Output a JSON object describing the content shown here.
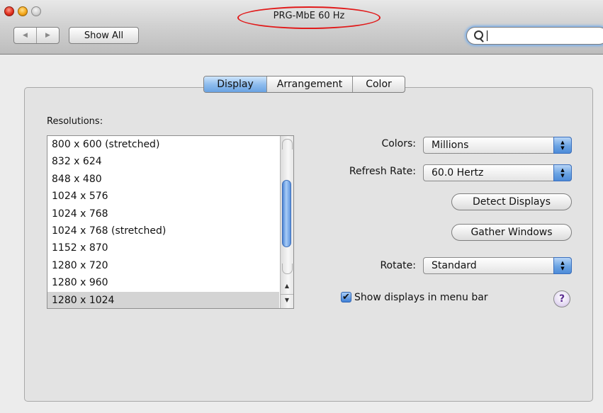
{
  "window": {
    "title": "PRG-MbE 60 Hz",
    "toolbar": {
      "back": "◀",
      "forward": "▶",
      "show_all": "Show All"
    },
    "search": {
      "value": ""
    }
  },
  "tabs": [
    {
      "label": "Display",
      "active": true
    },
    {
      "label": "Arrangement",
      "active": false
    },
    {
      "label": "Color",
      "active": false
    }
  ],
  "resolutions": {
    "label": "Resolutions:",
    "items": [
      "800 x 600 (stretched)",
      "832 x 624",
      "848 x 480",
      "1024 x 576",
      "1024 x 768",
      "1024 x 768 (stretched)",
      "1152 x 870",
      "1280 x 720",
      "1280 x 960",
      "1280 x 1024"
    ],
    "selected": "1280 x 1024"
  },
  "settings": {
    "colors_label": "Colors:",
    "colors_value": "Millions",
    "refresh_label": "Refresh Rate:",
    "refresh_value": "60.0 Hertz",
    "detect_button": "Detect Displays",
    "gather_button": "Gather Windows",
    "rotate_label": "Rotate:",
    "rotate_value": "Standard",
    "show_in_menu_bar_label": "Show displays in menu bar",
    "show_in_menu_bar_checked": true,
    "help": "?"
  },
  "colors": {
    "accent": "#6aa3e3",
    "title_highlight": "#e11a1a"
  }
}
